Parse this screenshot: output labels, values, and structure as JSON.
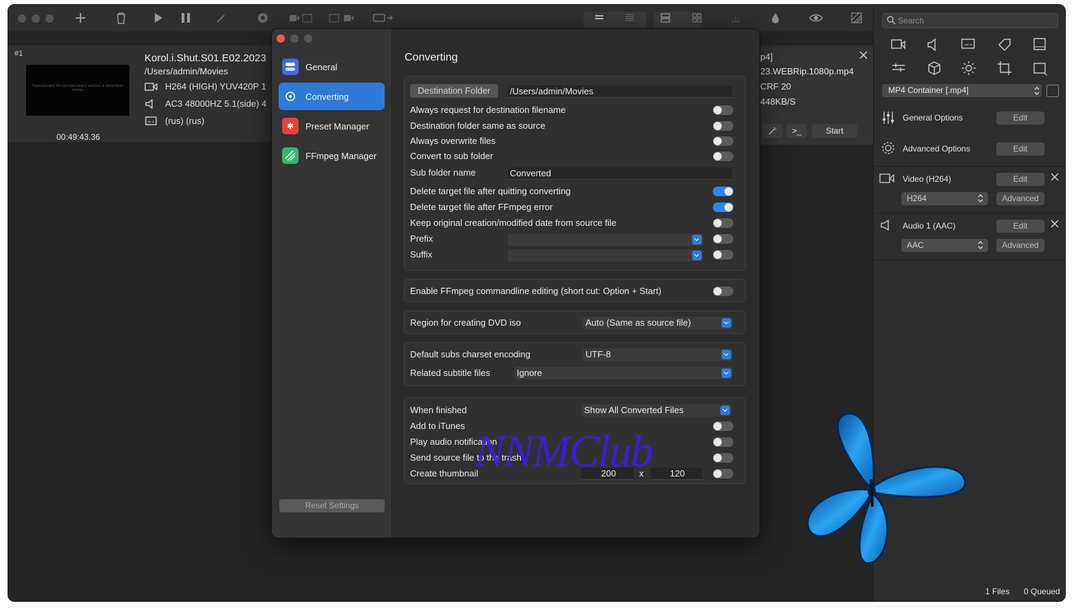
{
  "file": {
    "index": "#1",
    "title": "Korol.i.Shut.S01.E02.2023",
    "path": "/Users/admin/Movies",
    "video": "H264 (HIGH) YUV420P 1",
    "audio": "AC3 48000HZ 5.1(side) 4",
    "subs": "(rus) (rus)",
    "duration": "00:49:43.36",
    "thumb_text": "Аудиодорожку без цензуры можно выбрать в настройках плеера",
    "out_ext": "p4]",
    "out_name": "23.WEBRip.1080p.mp4",
    "out_crf": "CRF 20",
    "out_bitrate": "448KB/S",
    "term_label": ">_",
    "start_label": "Start"
  },
  "sidebar": {
    "search_placeholder": "Search",
    "container": "MP4 Container [.mp4]",
    "general_options": "General Options",
    "advanced_options": "Advanced Options",
    "video_track": "Video (H264)",
    "video_codec": "H264",
    "audio_track": "Audio 1 (AAC)",
    "audio_codec": "AAC",
    "edit_label": "Edit",
    "advanced_label": "Advanced",
    "files_count": "1 Files",
    "queued_count": "0 Queued"
  },
  "dialog": {
    "nav": [
      {
        "label": "General"
      },
      {
        "label": "Converting"
      },
      {
        "label": "Preset Manager"
      },
      {
        "label": "FFmpeg Manager"
      }
    ],
    "reset_label": "Reset Settings",
    "title": "Converting",
    "destination_folder_label": "Destination Folder",
    "destination_folder_value": "/Users/admin/Movies",
    "always_request": "Always request for destination filename",
    "dest_same_source": "Destination folder same as source",
    "overwrite": "Always overwrite files",
    "sub_folder": "Convert to sub folder",
    "sub_folder_name_label": "Sub folder name",
    "sub_folder_name_value": "Converted",
    "delete_after_quit": "Delete target file after quitting converting",
    "delete_after_error": "Delete target file after FFmpeg error",
    "keep_dates": "Keep original creation/modified date from source file",
    "prefix": "Prefix",
    "suffix": "Suffix",
    "cmdline": "Enable FFmpeg commandline editing (short cut: Option + Start)",
    "dvd_region_label": "Region for creating DVD iso",
    "dvd_region_value": "Auto (Same as source file)",
    "subs_charset_label": "Default subs charset encoding",
    "subs_charset_value": "UTF-8",
    "related_subs_label": "Related subtitle files",
    "related_subs_value": "Ignore",
    "when_finished_label": "When finished",
    "when_finished_value": "Show All Converted Files",
    "add_itunes": "Add to iTunes",
    "play_audio": "Play audio notification",
    "send_trash": "Send source file to the trash",
    "create_thumb": "Create thumbnail",
    "thumb_w": "200",
    "thumb_x": "x",
    "thumb_h": "120"
  },
  "watermark": "NNMClub",
  "colors": {
    "accent": "#2f7ad8",
    "toggle_on": "#2f86ee",
    "close": "#ee5a52"
  }
}
